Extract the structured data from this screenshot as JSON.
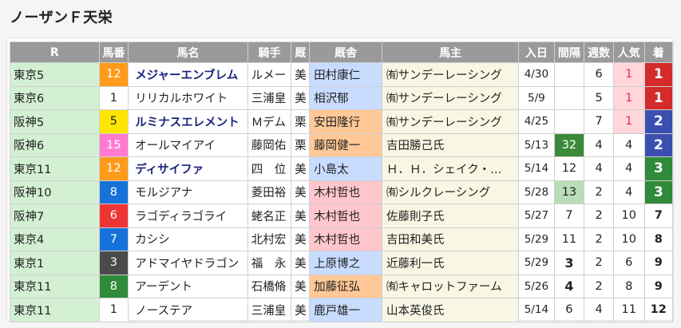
{
  "title": "ノーザンＦ天栄",
  "headers": [
    "R",
    "馬番",
    "馬名",
    "騎手",
    "厩",
    "厩舎",
    "馬主",
    "入日",
    "間隔",
    "週数",
    "人気",
    "着"
  ],
  "rows": [
    {
      "race": "東京5",
      "num": "12",
      "horse": "メジャーエンブレム",
      "bold": true,
      "jockey": "ルメー",
      "area": "美",
      "trainer": "田村康仁",
      "owner": "㈲サンデーレーシング",
      "date": "4/30",
      "interval": "",
      "weeks": "6",
      "pop": "1",
      "finish": "1",
      "numColor": "#ff9a1a",
      "numText": "#fff",
      "trainerColor": "#c8dcff",
      "popHi": true,
      "finishClass": "fin1",
      "intClass": ""
    },
    {
      "race": "東京6",
      "num": "1",
      "horse": "リリカルホワイト",
      "bold": false,
      "jockey": "三浦皇",
      "area": "美",
      "trainer": "相沢郁",
      "owner": "㈲サンデーレーシング",
      "date": "5/9",
      "interval": "",
      "weeks": "5",
      "pop": "1",
      "finish": "1",
      "numColor": "#ffffff",
      "numText": "#222",
      "trainerColor": "#c8dcff",
      "popHi": true,
      "finishClass": "fin1",
      "intClass": ""
    },
    {
      "race": "阪神5",
      "num": "5",
      "horse": "ルミナスエレメント",
      "bold": true,
      "jockey": "Ｍデム",
      "area": "栗",
      "trainer": "安田隆行",
      "owner": "㈲サンデーレーシング",
      "date": "4/25",
      "interval": "",
      "weeks": "7",
      "pop": "1",
      "finish": "2",
      "numColor": "#ffe600",
      "numText": "#222",
      "trainerColor": "#ffc896",
      "popHi": true,
      "finishClass": "fin2",
      "intClass": ""
    },
    {
      "race": "阪神6",
      "num": "15",
      "horse": "オールマイアイ",
      "bold": false,
      "jockey": "藤岡佑",
      "area": "栗",
      "trainer": "藤岡健一",
      "owner": "吉田勝己氏",
      "date": "5/13",
      "interval": "32",
      "weeks": "4",
      "pop": "4",
      "finish": "2",
      "numColor": "#ff7ad0",
      "numText": "#fff",
      "trainerColor": "#ffc896",
      "popHi": false,
      "finishClass": "fin2",
      "intClass": "int-hi"
    },
    {
      "race": "東京11",
      "num": "12",
      "horse": "ディサイファ",
      "bold": true,
      "jockey": "四　位",
      "area": "美",
      "trainer": "小島太",
      "owner": "Ｈ．Ｈ．シェイク・…",
      "date": "5/14",
      "interval": "12",
      "weeks": "4",
      "pop": "4",
      "finish": "3",
      "numColor": "#ff9a1a",
      "numText": "#fff",
      "trainerColor": "#c8dcff",
      "popHi": false,
      "finishClass": "fin3",
      "intClass": ""
    },
    {
      "race": "阪神10",
      "num": "8",
      "horse": "モルジアナ",
      "bold": false,
      "jockey": "菱田裕",
      "area": "美",
      "trainer": "木村哲也",
      "owner": "㈲シルクレーシング",
      "date": "5/28",
      "interval": "13",
      "weeks": "2",
      "pop": "4",
      "finish": "3",
      "numColor": "#1672d8",
      "numText": "#fff",
      "trainerColor": "#ffc6cc",
      "popHi": false,
      "finishClass": "fin3",
      "intClass": "int-mid"
    },
    {
      "race": "阪神7",
      "num": "6",
      "horse": "ラゴディラゴライ",
      "bold": false,
      "jockey": "蛯名正",
      "area": "美",
      "trainer": "木村哲也",
      "owner": "佐藤則子氏",
      "date": "5/27",
      "interval": "7",
      "weeks": "2",
      "pop": "10",
      "finish": "7",
      "numColor": "#ef3434",
      "numText": "#fff",
      "trainerColor": "#ffc6cc",
      "popHi": false,
      "finishClass": "",
      "intClass": ""
    },
    {
      "race": "東京4",
      "num": "7",
      "horse": "カシシ",
      "bold": false,
      "jockey": "北村宏",
      "area": "美",
      "trainer": "木村哲也",
      "owner": "吉田和美氏",
      "date": "5/29",
      "interval": "11",
      "weeks": "2",
      "pop": "10",
      "finish": "8",
      "numColor": "#1672d8",
      "numText": "#fff",
      "trainerColor": "#ffc6cc",
      "popHi": false,
      "finishClass": "",
      "intClass": ""
    },
    {
      "race": "東京1",
      "num": "3",
      "horse": "アドマイヤドラゴン",
      "bold": false,
      "jockey": "福　永",
      "area": "美",
      "trainer": "上原博之",
      "owner": "近藤利一氏",
      "date": "5/29",
      "interval": "3",
      "weeks": "2",
      "pop": "6",
      "finish": "9",
      "numColor": "#4a4a4a",
      "numText": "#fff",
      "trainerColor": "#c8dcff",
      "popHi": false,
      "finishClass": "",
      "intClass": "int-b"
    },
    {
      "race": "東京11",
      "num": "8",
      "horse": "アーデント",
      "bold": false,
      "jockey": "石橋脩",
      "area": "美",
      "trainer": "加藤征弘",
      "owner": "㈲キャロットファーム",
      "date": "5/26",
      "interval": "4",
      "weeks": "2",
      "pop": "8",
      "finish": "9",
      "numColor": "#2f8a3a",
      "numText": "#fff",
      "trainerColor": "#ffc896",
      "popHi": false,
      "finishClass": "",
      "intClass": "int-b"
    },
    {
      "race": "東京11",
      "num": "1",
      "horse": "ノーステア",
      "bold": false,
      "jockey": "三浦皇",
      "area": "美",
      "trainer": "鹿戸雄一",
      "owner": "山本英俊氏",
      "date": "5/14",
      "interval": "6",
      "weeks": "4",
      "pop": "11",
      "finish": "12",
      "numColor": "#ffffff",
      "numText": "#222",
      "trainerColor": "#c8dcff",
      "popHi": false,
      "finishClass": "",
      "intClass": ""
    }
  ]
}
